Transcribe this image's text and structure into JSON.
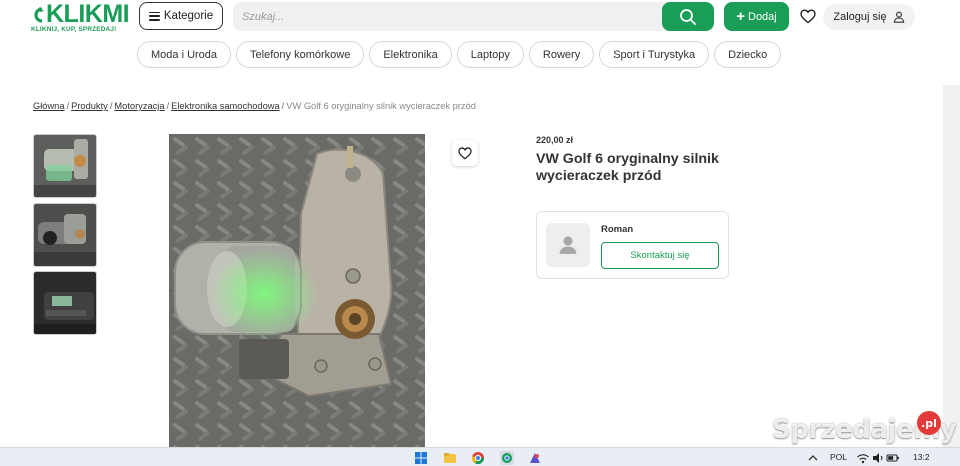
{
  "header": {
    "logo_text": "KLIKMI",
    "logo_tagline": "KLIKNIJ, KUP, SPRZEDAJ!",
    "categories_button": "Kategorie",
    "search_placeholder": "Szukaj...",
    "add_button": "Dodaj",
    "login_button": "Zaloguj się"
  },
  "categories": [
    "Moda i Uroda",
    "Telefony komórkowe",
    "Elektronika",
    "Laptopy",
    "Rowery",
    "Sport i Turystyka",
    "Dziecko"
  ],
  "breadcrumb": {
    "items": [
      "Główna",
      "Produkty",
      "Motoryzacja",
      "Elektronika samochodowa"
    ],
    "current": "VW Golf 6 oryginalny silnik wycieraczek przód"
  },
  "product": {
    "price": "220,00 zł",
    "title": "VW Golf 6 oryginalny silnik wycieraczek przód",
    "thumbnail_count": 3
  },
  "seller": {
    "name": "Roman",
    "contact_button": "Skontaktuj się"
  },
  "watermark": {
    "text": "Sprzedajemy",
    "badge": ".pl"
  },
  "taskbar": {
    "language": "POL",
    "time": "13:2"
  },
  "colors": {
    "brand": "#1a9d57",
    "watermark_badge": "#e23a3a"
  }
}
